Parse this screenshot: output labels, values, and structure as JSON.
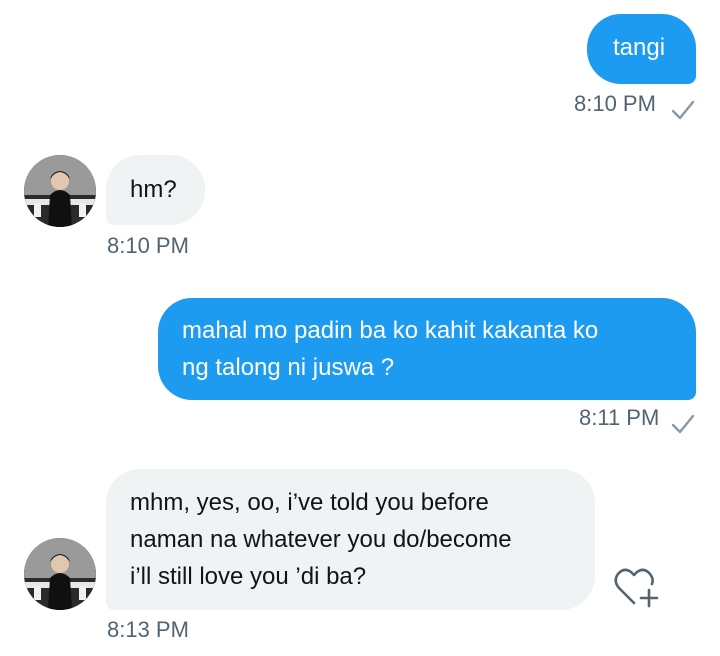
{
  "messages": [
    {
      "type": "sent",
      "lines": [
        "tangi"
      ],
      "time": "8:10 PM"
    },
    {
      "type": "received",
      "lines": [
        "hm?"
      ],
      "time": "8:10 PM"
    },
    {
      "type": "sent",
      "lines": [
        "mahal mo padin ba ko kahit kakanta ko",
        "ng talong ni juswa ?"
      ],
      "time": "8:11 PM"
    },
    {
      "type": "received",
      "lines": [
        "mhm, yes, oo, i’ve told you before",
        "naman na whatever you do/become",
        "i’ll still love you ’di ba?"
      ],
      "time": "8:13 PM"
    }
  ],
  "icons": {
    "read_check": "checkmark-icon",
    "react": "heart-plus-icon",
    "avatar": "user-avatar"
  },
  "colors": {
    "sent_bubble": "#1d9bf0",
    "received_bubble": "#eff3f4",
    "timestamp": "#536471"
  }
}
